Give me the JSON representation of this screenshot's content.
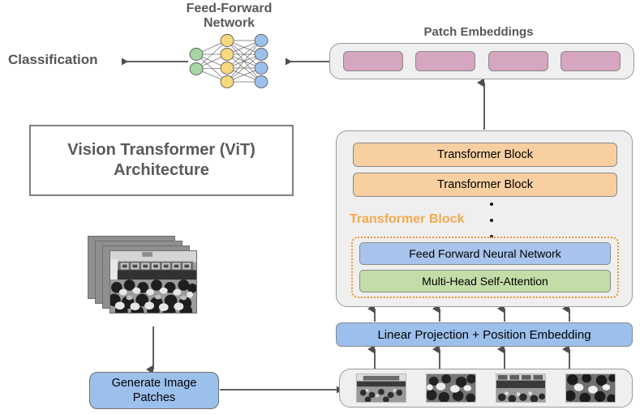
{
  "diagram": {
    "title_line1": "Vision Transformer (ViT)",
    "title_line2": "Architecture"
  },
  "classification": {
    "label": "Classification"
  },
  "feed_forward_network": {
    "title_line1": "Feed-Forward",
    "title_line2": "Network",
    "layers": [
      {
        "name": "input",
        "nodes": 2,
        "color": "#a6d6a3"
      },
      {
        "name": "hidden",
        "nodes": 4,
        "color": "#f7d87c"
      },
      {
        "name": "output",
        "nodes": 4,
        "color": "#9cc0ec"
      }
    ]
  },
  "patch_embeddings": {
    "title": "Patch Embeddings",
    "chip_count": 4,
    "chip_color": "#d6a5bf"
  },
  "transformer_stack": {
    "blocks": [
      {
        "label": "Transformer Block"
      },
      {
        "label": "Transformer Block"
      }
    ],
    "ellipsis_dots": 3,
    "expanded_caption": "Transformer Block",
    "expanded_caption_color": "#f5a94d",
    "inner_layers": [
      {
        "label": "Feed Forward Neural Network",
        "color": "#a8c4ec"
      },
      {
        "label": "Multi-Head Self-Attention",
        "color": "#c3dda8"
      }
    ],
    "block_color": "#f8cfa0",
    "input_arrow_count": 4
  },
  "linear_projection": {
    "label": "Linear Projection + Position Embedding",
    "color": "#9cc0ec"
  },
  "image_patches": {
    "patch_count": 4
  },
  "generate_patches": {
    "label_line1": "Generate Image",
    "label_line2": "Patches",
    "color": "#9cc0ec"
  },
  "source_image": {
    "sheet_count": 4
  },
  "colors": {
    "container_fill": "#efefef",
    "container_border": "#9a9a9a",
    "text_gray": "#595959",
    "arrow": "#4d4d4d",
    "orange_dotted": "#f0962c"
  }
}
